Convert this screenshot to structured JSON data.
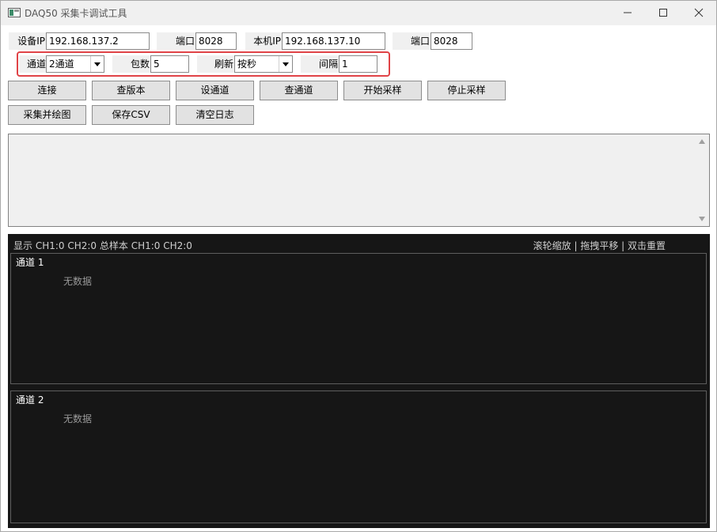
{
  "window": {
    "title": "DAQ50 采集卡调试工具"
  },
  "row1": {
    "device_ip_label": "设备IP",
    "device_ip_value": "192.168.137.2",
    "port_label": "端口",
    "port_value": "8028",
    "local_ip_label": "本机IP",
    "local_ip_value": "192.168.137.10",
    "local_port_label": "端口",
    "local_port_value": "8028"
  },
  "row2": {
    "channel_label": "通道",
    "channel_value": "2通道",
    "packets_label": "包数",
    "packets_value": "5",
    "refresh_label": "刷新",
    "refresh_value": "按秒",
    "interval_label": "间隔",
    "interval_value": "1"
  },
  "buttons": {
    "connect": "连接",
    "query_version": "查版本",
    "set_channel": "设通道",
    "query_channel": "查通道",
    "start_sampling": "开始采样",
    "stop_sampling": "停止采样",
    "sample_and_plot": "采集并绘图",
    "save_csv": "保存CSV",
    "clear_log": "清空日志"
  },
  "log": {
    "content": ""
  },
  "plot": {
    "status_left": "显示 CH1:0  CH2:0  总样本 CH1:0  CH2:0",
    "status_right": "滚轮缩放 | 拖拽平移 | 双击重置",
    "panels": [
      {
        "title": "通道 1",
        "empty_text": "无数据"
      },
      {
        "title": "通道 2",
        "empty_text": "无数据"
      }
    ]
  },
  "colors": {
    "highlight_border": "#e04347",
    "plot_background": "#161616",
    "titlebar": "#f0f0f0"
  },
  "icons": [
    "app-icon",
    "minimize-icon",
    "maximize-icon",
    "close-icon",
    "dropdown-arrow-icon",
    "scroll-up-icon",
    "scroll-down-icon"
  ]
}
